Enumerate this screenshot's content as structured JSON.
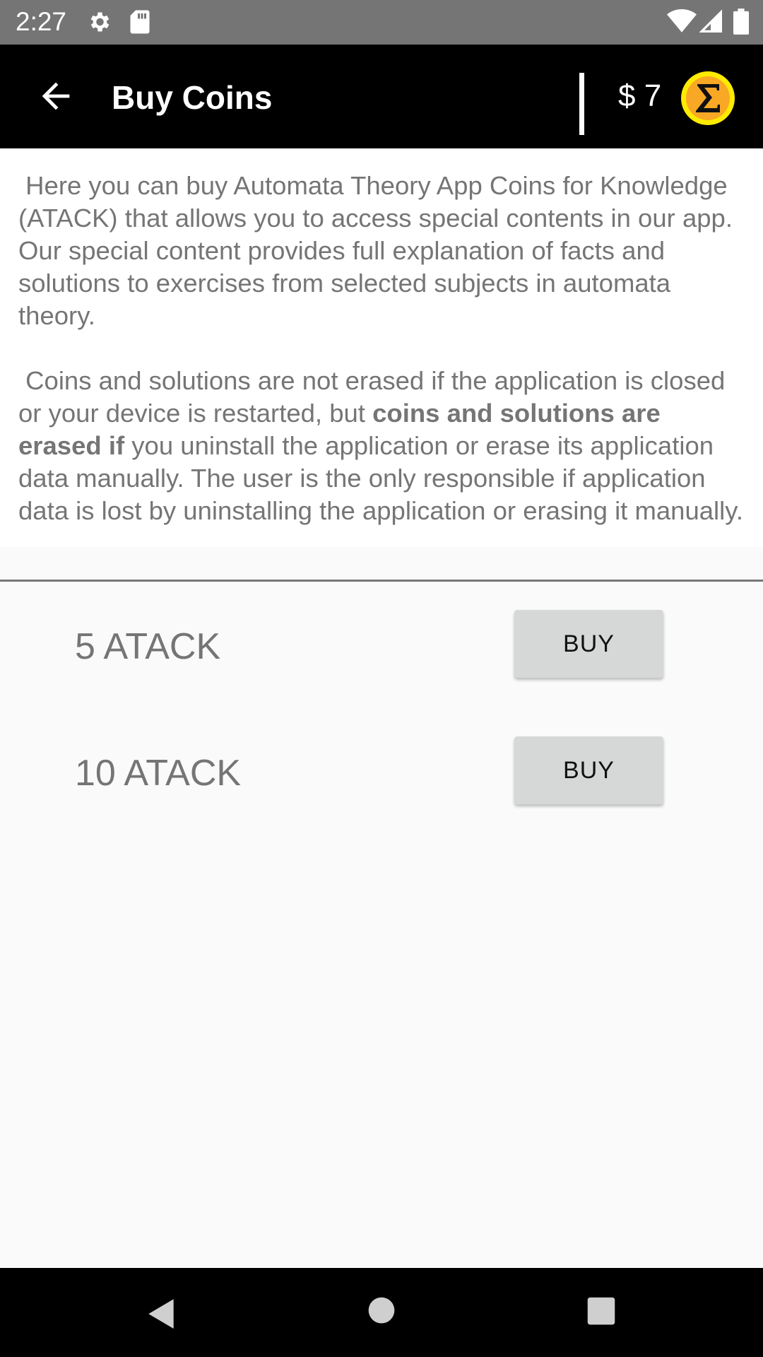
{
  "status_bar": {
    "time": "2:27"
  },
  "app_bar": {
    "title": "Buy Coins",
    "balance": "$ 7"
  },
  "intro": {
    "p1": " Here you can buy Automata Theory App Coins for Knowledge (ATACK) that allows you to access special contents in our app. Our special content provides full explanation of facts and solutions to exercises from selected subjects in automata theory.",
    "p2_start": " Coins and solutions are not erased if the application is closed or your device is restarted, but ",
    "p2_bold": "coins and solutions are erased if",
    "p2_end": " you uninstall the application or erase its application data manually. The user is the only responsible if application data is lost by uninstalling the application or erasing it manually."
  },
  "products": [
    {
      "label": "5 ATACK",
      "button": "BUY"
    },
    {
      "label": "10 ATACK",
      "button": "BUY"
    }
  ],
  "colors": {
    "accent_coin": "#f9a825",
    "coin_ring": "#ffeb00"
  }
}
